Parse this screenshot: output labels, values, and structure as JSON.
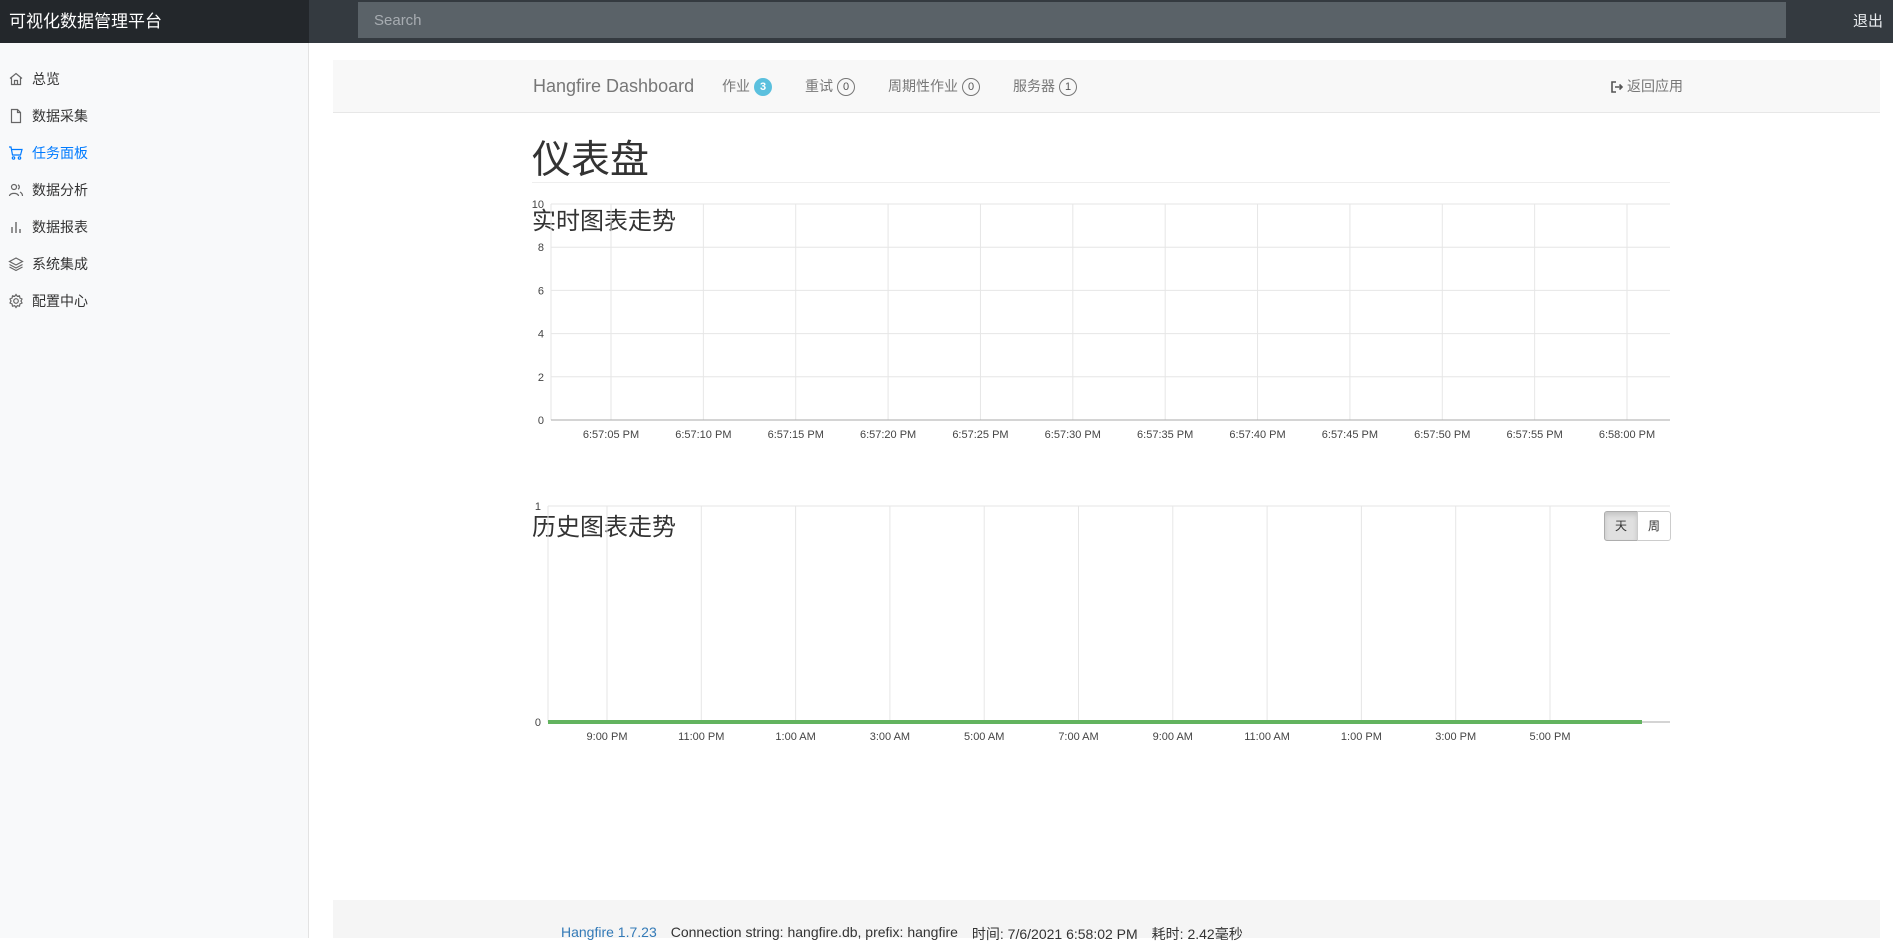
{
  "app": {
    "title": "可视化数据管理平台",
    "logout": "退出"
  },
  "search": {
    "placeholder": "Search"
  },
  "sidebar": {
    "items": [
      {
        "label": "总览",
        "icon": "home-icon",
        "active": false
      },
      {
        "label": "数据采集",
        "icon": "file-icon",
        "active": false
      },
      {
        "label": "任务面板",
        "icon": "cart-icon",
        "active": true
      },
      {
        "label": "数据分析",
        "icon": "users-icon",
        "active": false
      },
      {
        "label": "数据报表",
        "icon": "bar-chart-icon",
        "active": false
      },
      {
        "label": "系统集成",
        "icon": "layers-icon",
        "active": false
      },
      {
        "label": "配置中心",
        "icon": "gear-icon",
        "active": false
      }
    ]
  },
  "hangfire": {
    "brand": "Hangfire Dashboard",
    "nav": [
      {
        "label": "作业",
        "count": "3",
        "style": "info"
      },
      {
        "label": "重试",
        "count": "0",
        "style": "default"
      },
      {
        "label": "周期性作业",
        "count": "0",
        "style": "default"
      },
      {
        "label": "服务器",
        "count": "1",
        "style": "default"
      }
    ],
    "back": "返回应用",
    "page_title": "仪表盘",
    "realtime_title": "实时图表走势",
    "history_title": "历史图表走势",
    "period_buttons": [
      {
        "label": "天",
        "active": true
      },
      {
        "label": "周",
        "active": false
      }
    ]
  },
  "chart_data": [
    {
      "type": "line",
      "x": [
        "6:57:05 PM",
        "6:57:10 PM",
        "6:57:15 PM",
        "6:57:20 PM",
        "6:57:25 PM",
        "6:57:30 PM",
        "6:57:35 PM",
        "6:57:40 PM",
        "6:57:45 PM",
        "6:57:50 PM",
        "6:57:55 PM",
        "6:58:00 PM"
      ],
      "yticks": [
        "0",
        "2",
        "4",
        "6",
        "8",
        "10"
      ],
      "ylim": [
        0,
        10
      ],
      "series": [],
      "grid": true
    },
    {
      "type": "line",
      "x": [
        "9:00 PM",
        "11:00 PM",
        "1:00 AM",
        "3:00 AM",
        "5:00 AM",
        "7:00 AM",
        "9:00 AM",
        "11:00 AM",
        "1:00 PM",
        "3:00 PM",
        "5:00 PM"
      ],
      "yticks": [
        "0",
        "1"
      ],
      "ylim": [
        0,
        1
      ],
      "series": [
        {
          "values": [
            0,
            0,
            0,
            0,
            0,
            0,
            0,
            0,
            0,
            0,
            0
          ],
          "color": "#62b35f"
        }
      ],
      "grid": true
    }
  ],
  "footer": {
    "version": "Hangfire 1.7.23",
    "connection": "Connection string: hangfire.db, prefix: hangfire",
    "time": "时间: 7/6/2021 6:58:02 PM",
    "elapsed": "耗时: 2.42毫秒"
  }
}
